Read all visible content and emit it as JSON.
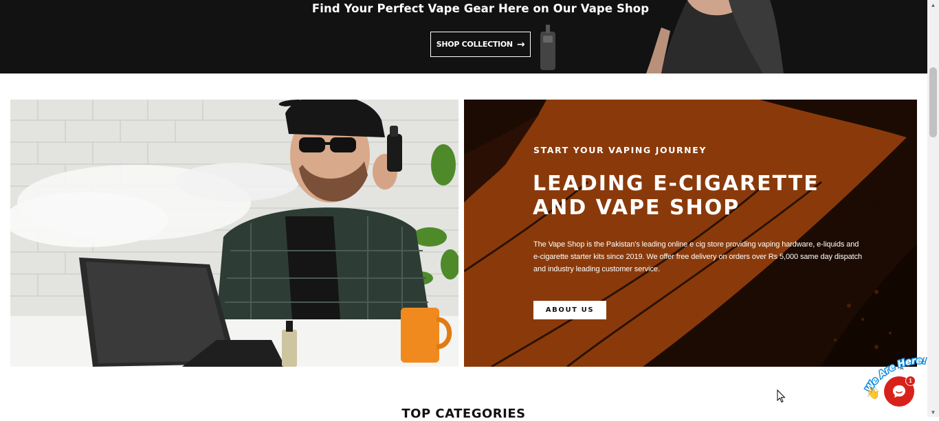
{
  "hero": {
    "subtitle": "Find Your Perfect Vape Gear Here on Our Vape Shop",
    "shop_button_label": "SHOP COLLECTION",
    "shop_button_icon": "arrow-right-icon"
  },
  "promo": {
    "eyebrow": "START YOUR VAPING JOURNEY",
    "title_line1": "LEADING E-CIGARETTE",
    "title_line2": "AND VAPE SHOP",
    "body": "The Vape Shop is the Pakistan's leading online e cig store providing vaping hardware, e-liquids and e-cigarette starter kits since 2019. We offer free delivery on orders over Rs 5,000 same day dispatch and industry leading customer service.",
    "button_label": "ABOUT US"
  },
  "section": {
    "title": "TOP CATEGORIES"
  },
  "chat": {
    "badge_text": "We Are Here!",
    "unread_count": "1",
    "scroll_top_icon": "chevron-up-icon"
  },
  "colors": {
    "hero_bg": "#121212",
    "promo_bg": "#8a3a0a",
    "promo_dark": "#1c0b02",
    "chat_red": "#d9211b"
  }
}
